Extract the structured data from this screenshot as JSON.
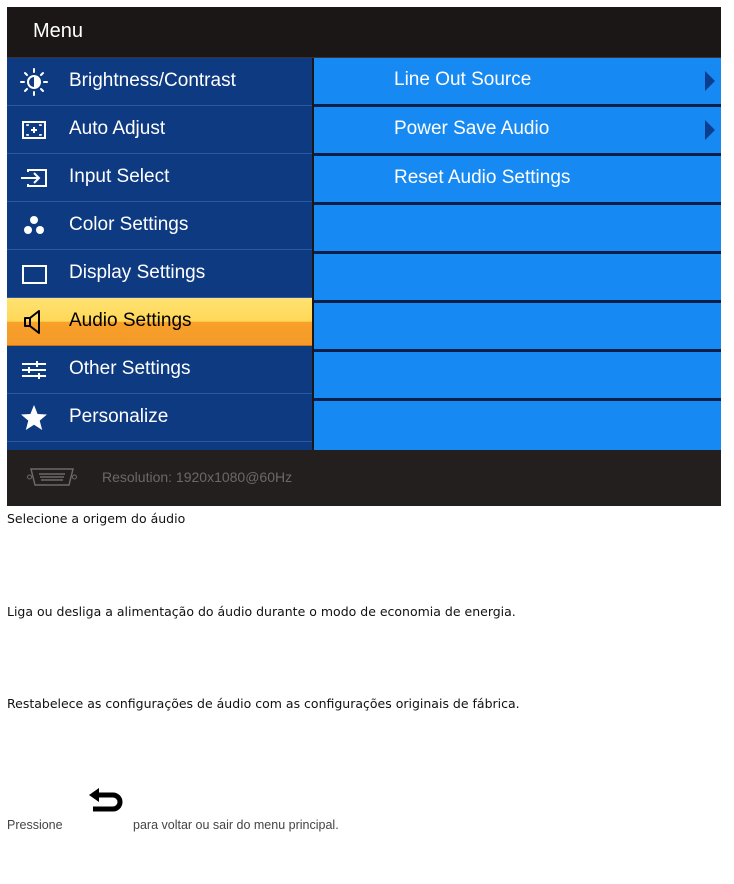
{
  "osd": {
    "title": "Menu",
    "menu_items": [
      {
        "label": "Brightness/Contrast",
        "icon": "brightness-icon"
      },
      {
        "label": "Auto Adjust",
        "icon": "auto-adjust-icon"
      },
      {
        "label": "Input Select",
        "icon": "input-select-icon"
      },
      {
        "label": "Color Settings",
        "icon": "color-settings-icon"
      },
      {
        "label": "Display Settings",
        "icon": "display-settings-icon"
      },
      {
        "label": "Audio Settings",
        "icon": "speaker-icon",
        "selected": true
      },
      {
        "label": "Other Settings",
        "icon": "sliders-icon"
      },
      {
        "label": "Personalize",
        "icon": "star-icon"
      }
    ],
    "submenu_items": [
      {
        "label": "Line Out Source",
        "has_arrow": true
      },
      {
        "label": "Power Save Audio",
        "has_arrow": true
      },
      {
        "label": "Reset Audio Settings",
        "has_arrow": false
      },
      {
        "label": ""
      },
      {
        "label": ""
      },
      {
        "label": ""
      },
      {
        "label": ""
      },
      {
        "label": ""
      }
    ],
    "footer": {
      "resolution_text": "Resolution: 1920x1080@60Hz",
      "connector_icon": "vga-connector-icon"
    }
  },
  "descriptions": {
    "line_out_source": "Selecione a origem do áudio",
    "power_save_audio": "Liga ou desliga a alimentação do áudio durante o modo de economia de energia.",
    "reset_audio": "Restabelece as configurações de áudio com as configurações originais de fábrica."
  },
  "back_note": {
    "before": "Pressione",
    "after": "para voltar ou sair do menu principal.",
    "icon": "back-arrow-icon"
  },
  "colors": {
    "left_panel": "#0e3a82",
    "submenu": "#1689f2",
    "selected_highlight": "#f8a029",
    "frame": "#1a1716"
  }
}
